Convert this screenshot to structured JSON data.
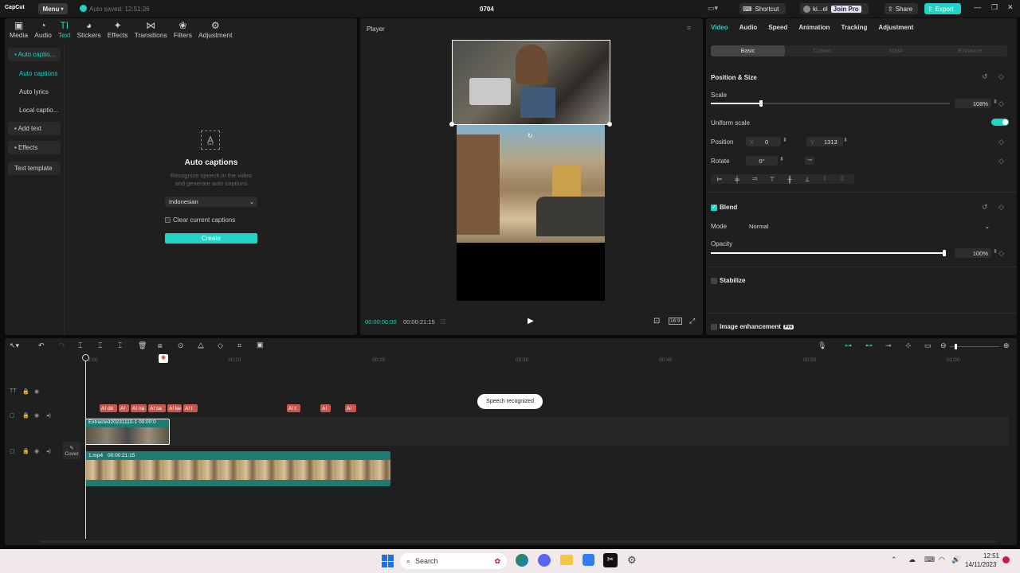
{
  "titlebar": {
    "app_name": "CapCut",
    "menu_label": "Menu",
    "autosave": "Auto saved: 12:51:26",
    "project_title": "0704",
    "shortcut_label": "Shortcut",
    "user_name": "ki...el",
    "join_pro": "Join Pro",
    "share_label": "Share",
    "export_label": "Export"
  },
  "toolbar": {
    "items": [
      {
        "icon": "media-icon",
        "label": "Media"
      },
      {
        "icon": "audio-icon",
        "label": "Audio"
      },
      {
        "icon": "text-icon",
        "label": "Text"
      },
      {
        "icon": "stickers-icon",
        "label": "Stickers"
      },
      {
        "icon": "effects-icon",
        "label": "Effects"
      },
      {
        "icon": "transitions-icon",
        "label": "Transitions"
      },
      {
        "icon": "filters-icon",
        "label": "Filters"
      },
      {
        "icon": "adjustment-icon",
        "label": "Adjustment"
      }
    ],
    "active": "Text"
  },
  "text_sidebar": {
    "items": [
      {
        "label": "• Auto captio...",
        "state": "group-active"
      },
      {
        "label": "Auto captions",
        "state": "selected"
      },
      {
        "label": "Auto lyrics",
        "state": "normal"
      },
      {
        "label": "Local captio...",
        "state": "normal"
      },
      {
        "label": "• Add text",
        "state": "group"
      },
      {
        "label": "• Effects",
        "state": "group"
      },
      {
        "label": "Text template",
        "state": "group"
      }
    ]
  },
  "auto_captions": {
    "title": "Auto captions",
    "description_1": "Recognize speech in the video",
    "description_2": "and generate auto captions",
    "language": "Indonesian",
    "clear_label": "Clear current captions",
    "create_label": "Create"
  },
  "player": {
    "title": "Player",
    "current_time": "00:00:00:00",
    "total_time": "00:00:21:15",
    "ratio_label": "16:9"
  },
  "inspector": {
    "tabs": [
      "Video",
      "Audio",
      "Speed",
      "Animation",
      "Tracking",
      "Adjustment"
    ],
    "active_tab": "Video",
    "subtabs": [
      "Basic",
      "Cutout",
      "Mask",
      "Enhance"
    ],
    "active_subtab": "Basic",
    "position_size_title": "Position & Size",
    "scale_label": "Scale",
    "scale_value": "108%",
    "scale_fraction": 0.21,
    "uniform_scale_label": "Uniform scale",
    "position_label": "Position",
    "pos_x_label": "X",
    "pos_x": "0",
    "pos_y_label": "Y",
    "pos_y": "1313",
    "rotate_label": "Rotate",
    "rotate_value": "0°",
    "blend_title": "Blend",
    "mode_label": "Mode",
    "mode_value": "Normal",
    "opacity_label": "Opacity",
    "opacity_value": "100%",
    "opacity_fraction": 1.0,
    "stabilize_title": "Stabilize",
    "enhancement_title": "Image enhancement",
    "pro_badge": "Pro"
  },
  "timeline": {
    "ruler": [
      "00:00",
      "00:10",
      "00:20",
      "00:30",
      "00:40",
      "00:50",
      "01:00"
    ],
    "caption_chips": [
      "A! dé",
      "A!",
      "A! na",
      "A! sa",
      "A! ke",
      "A! l",
      "A! t",
      "A!",
      "A!"
    ],
    "speech_toast": "Speech recognized",
    "overlay_clip": "Extracted20231110-1  00:00:0",
    "main_clip_name": "1.mp4",
    "main_clip_duration": "00:00:21:15",
    "cover_label": "Cover"
  },
  "taskbar": {
    "search_placeholder": "Search",
    "time": "12:51",
    "date": "14/11/2023"
  },
  "colors": {
    "accent": "#22d3c5",
    "caption_clip": "#c8584c",
    "video_track": "#1f7a73",
    "panel": "#1f1f1f"
  }
}
